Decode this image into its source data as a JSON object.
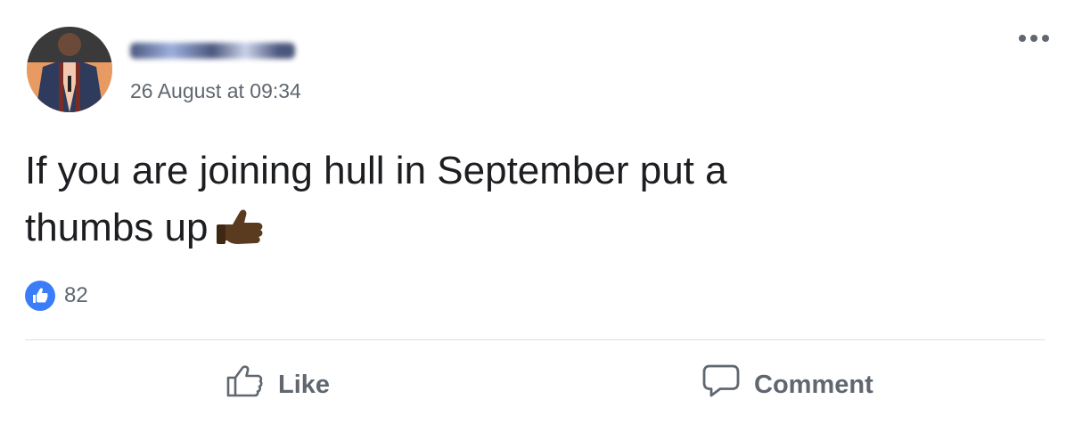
{
  "post": {
    "timestamp": "26 August at 09:34",
    "text_lines": [
      "If you are joining hull in September put a",
      "thumbs up"
    ],
    "emoji": "thumbs-up-dark-skin-tone",
    "reactions": {
      "count": "82",
      "type": "like"
    },
    "actions": {
      "like_label": "Like",
      "comment_label": "Comment"
    }
  },
  "colors": {
    "like_blue": "#3b7df8",
    "secondary_text": "#606770",
    "primary_text": "#1c1e21"
  }
}
